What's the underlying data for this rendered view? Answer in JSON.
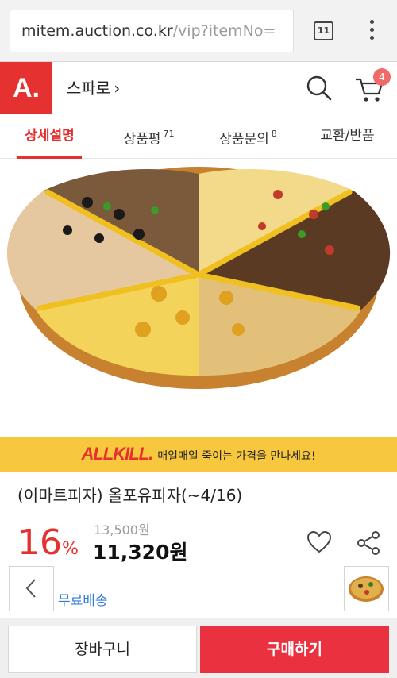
{
  "browser": {
    "url_host": "mitem.auction.co.kr",
    "url_path": "/vip?itemNo=",
    "tab_count": "11",
    "menu_icon": "more-vert-icon"
  },
  "header": {
    "logo_text": "A.",
    "store_name": "스파로",
    "store_chevron": "›",
    "cart_count": "4",
    "brand_color": "#e5312f"
  },
  "tabs": [
    {
      "label": "상세설명",
      "count": "",
      "active": true
    },
    {
      "label": "상품평",
      "count": "71",
      "active": false
    },
    {
      "label": "상품문의",
      "count": "8",
      "active": false
    },
    {
      "label": "교환/반품",
      "count": "",
      "active": false
    }
  ],
  "banner": {
    "brand": "ALLKILL.",
    "text": "매일매일 죽이는 가격을 만나세요!",
    "background": "#f7c73e"
  },
  "product": {
    "title": "(이마트피자) 올포유피자(~4/16)",
    "discount_number": "16",
    "discount_unit": "%",
    "original_price": "13,500원",
    "sale_price": "11,320원",
    "shipping": "무료배송"
  },
  "actions": {
    "add_to_cart": "장바구니",
    "buy_now": "구매하기",
    "buy_color": "#ea3140"
  }
}
